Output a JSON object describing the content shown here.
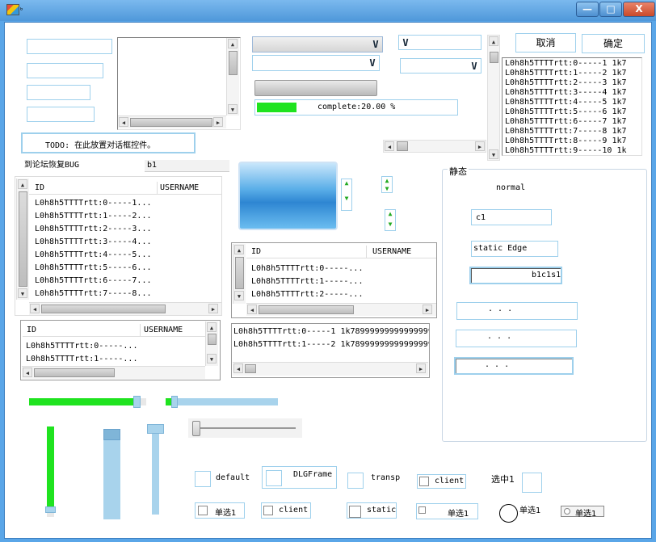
{
  "window": {
    "title": "ᵇ",
    "minimize": "—",
    "maximize": "□",
    "close": "X"
  },
  "buttons": {
    "cancel": "取消",
    "ok": "确定"
  },
  "combo": {
    "arrow": "V"
  },
  "progress": {
    "text": "complete:20.00 %",
    "value": 0.2
  },
  "todo_label": "TODO: 在此放置对话框控件。",
  "forum_label": "到论坛恢复BUG",
  "b1_edit": "b1",
  "right_list": {
    "rows": [
      "L0h8h5TTTTrtt:0-----1 1k7",
      "L0h8h5TTTTrtt:1-----2 1k7",
      "L0h8h5TTTTrtt:2-----3 1k7",
      "L0h8h5TTTTrtt:3-----4 1k7",
      "L0h8h5TTTTrtt:4-----5 1k7",
      "L0h8h5TTTTrtt:5-----6 1k7",
      "L0h8h5TTTTrtt:6-----7 1k7",
      "L0h8h5TTTTrtt:7-----8 1k7",
      "L0h8h5TTTTrtt:8-----9 1k7",
      "L0h8h5TTTTrtt:9-----10 1k"
    ]
  },
  "listview1": {
    "columns": [
      "ID",
      "USERNAME"
    ],
    "rows": [
      "L0h8h5TTTTrtt:0-----1...",
      "L0h8h5TTTTrtt:1-----2...",
      "L0h8h5TTTTrtt:2-----3...",
      "L0h8h5TTTTrtt:3-----4...",
      "L0h8h5TTTTrtt:4-----5...",
      "L0h8h5TTTTrtt:5-----6...",
      "L0h8h5TTTTrtt:6-----7...",
      "L0h8h5TTTTrtt:7-----8..."
    ]
  },
  "listview2": {
    "columns": [
      "ID",
      "USERNAME"
    ],
    "rows": [
      "L0h8h5TTTTrtt:0-----...",
      "L0h8h5TTTTrtt:1-----...",
      "L0h8h5TTTTrtt:2-----..."
    ]
  },
  "listview3": {
    "columns": [
      "ID",
      "USERNAME"
    ],
    "rows": [
      "L0h8h5TTTTrtt:0-----...",
      "L0h8h5TTTTrtt:1-----..."
    ]
  },
  "listview4": {
    "rows": [
      "L0h8h5TTTTrtt:0-----1 1k7899999999999999999",
      "L0h8h5TTTTrtt:1-----2 1k7899999999999999999"
    ]
  },
  "static_group": {
    "title": "静态",
    "normal": "normal",
    "c1": "c1",
    "static_edge": "static Edge",
    "b1c1s1": "b1c1s1",
    "dots": ".        .        .",
    "dots2": ".        .        .",
    "dots3": ".        .        ."
  },
  "sliders": {
    "h_green_value": 0.95,
    "h_blue_value": 0.05,
    "h_plain_value": 0.0,
    "v_green_value": 0.95
  },
  "checks": {
    "default": "default",
    "dlgframe": "DLGFrame",
    "transp": "transp",
    "client": "client",
    "selected1": "选中1",
    "radio1": "单选1",
    "client2": "client",
    "static": "static",
    "radio2": "单选1",
    "radio3": "单选1",
    "radio_btn": "单选1"
  }
}
